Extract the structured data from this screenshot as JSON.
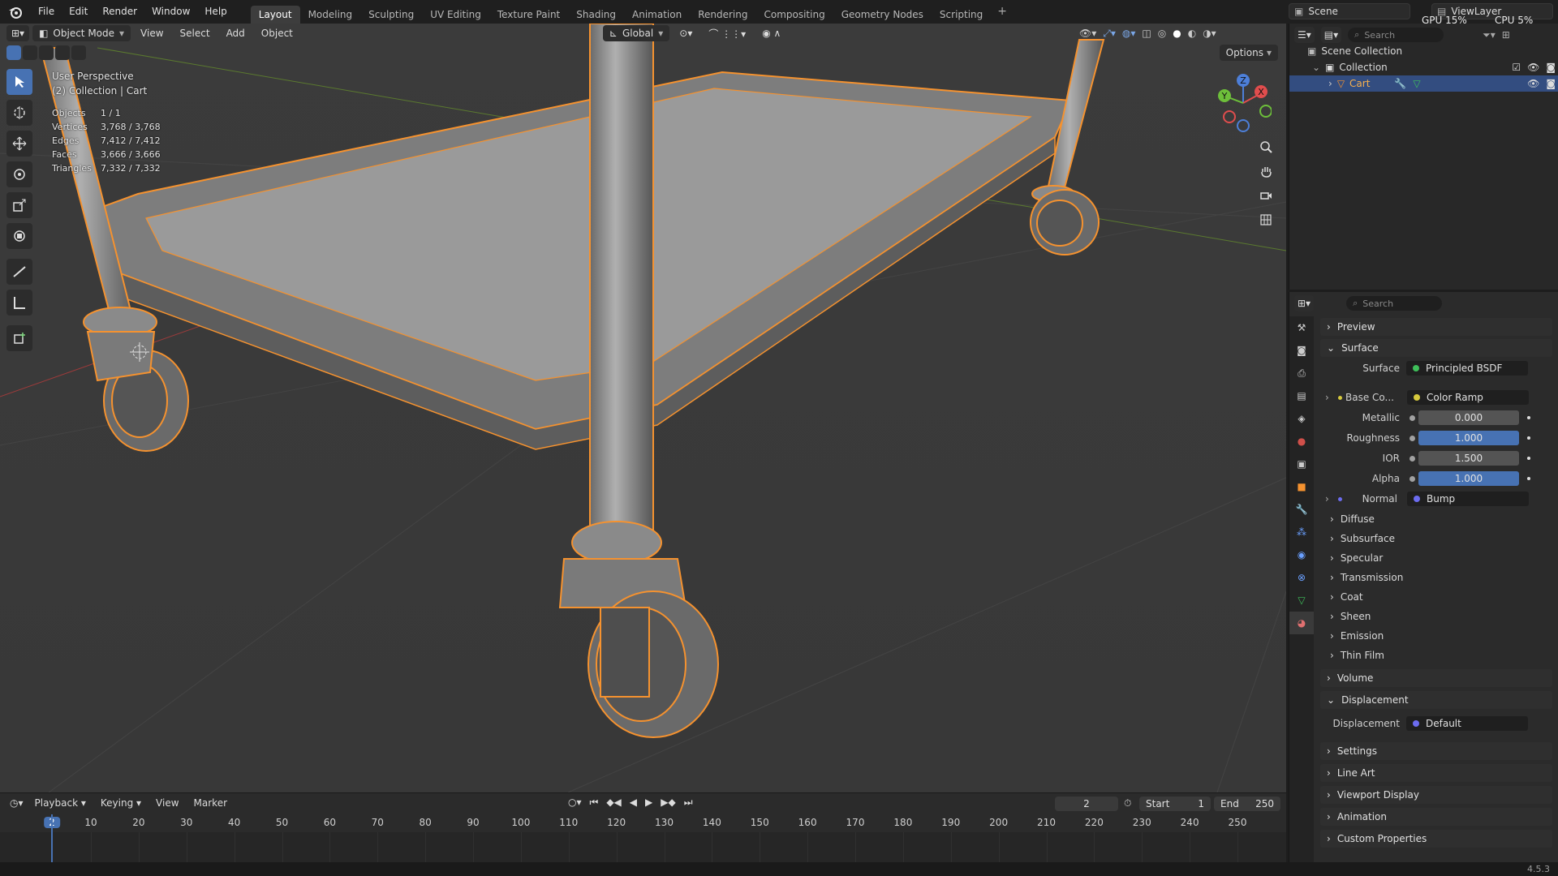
{
  "topbar": {
    "menus": [
      "File",
      "Edit",
      "Render",
      "Window",
      "Help"
    ],
    "workspaces": [
      "Layout",
      "Modeling",
      "Sculpting",
      "UV Editing",
      "Texture Paint",
      "Shading",
      "Animation",
      "Rendering",
      "Compositing",
      "Geometry Nodes",
      "Scripting"
    ],
    "active_workspace": "Layout",
    "add_tab": "+",
    "scene": "Scene",
    "view_layer": "ViewLayer",
    "gpu": "GPU 15%",
    "cpu": "CPU 5%"
  },
  "viewport": {
    "mode": "Object Mode",
    "menus": [
      "View",
      "Select",
      "Add",
      "Object"
    ],
    "orientation": "Global",
    "options": "Options",
    "perspective": "User Perspective",
    "collection_info": "(2) Collection | Cart",
    "stats": [
      {
        "label": "Objects",
        "value": "1 / 1"
      },
      {
        "label": "Vertices",
        "value": "3,768 / 3,768"
      },
      {
        "label": "Edges",
        "value": "7,412 / 7,412"
      },
      {
        "label": "Faces",
        "value": "3,666 / 3,666"
      },
      {
        "label": "Triangles",
        "value": "7,332 / 7,332"
      }
    ],
    "gizmo": {
      "x": "X",
      "y": "Y",
      "z": "Z"
    }
  },
  "timeline": {
    "menus": [
      "Playback",
      "Keying",
      "View",
      "Marker"
    ],
    "current_frame": "2",
    "start_label": "Start",
    "start": "1",
    "end_label": "End",
    "end": "250",
    "ticks": [
      "2",
      "10",
      "20",
      "30",
      "40",
      "50",
      "60",
      "70",
      "80",
      "90",
      "100",
      "110",
      "120",
      "130",
      "140",
      "150",
      "160",
      "170",
      "180",
      "190",
      "200",
      "210",
      "220",
      "230",
      "240",
      "250"
    ]
  },
  "status": {
    "version": "4.5.3"
  },
  "outliner": {
    "search_placeholder": "Search",
    "scene_collection": "Scene Collection",
    "collection": "Collection",
    "object": "Cart"
  },
  "properties": {
    "search_placeholder": "Search",
    "sections": {
      "preview": "Preview",
      "surface": "Surface",
      "volume": "Volume",
      "displacement": "Displacement",
      "settings": "Settings",
      "line_art": "Line Art",
      "viewport_display": "Viewport Display",
      "animation": "Animation",
      "custom_properties": "Custom Properties"
    },
    "surface_label": "Surface",
    "surface_value": "Principled BSDF",
    "base_color_label": "Base Co...",
    "base_color_value": "Color Ramp",
    "metallic_label": "Metallic",
    "metallic": "0.000",
    "roughness_label": "Roughness",
    "roughness": "1.000",
    "ior_label": "IOR",
    "ior": "1.500",
    "alpha_label": "Alpha",
    "alpha": "1.000",
    "normal_label": "Normal",
    "normal_value": "Bump",
    "subpanels": [
      "Diffuse",
      "Subsurface",
      "Specular",
      "Transmission",
      "Coat",
      "Sheen",
      "Emission",
      "Thin Film"
    ],
    "displacement_label": "Displacement",
    "displacement_value": "Default"
  },
  "colors": {
    "accent": "#4772b3",
    "selection": "#f5922f",
    "socket_green": "#3fbf5a",
    "socket_yellow": "#d6c93d",
    "socket_purple": "#6c6cf0"
  }
}
